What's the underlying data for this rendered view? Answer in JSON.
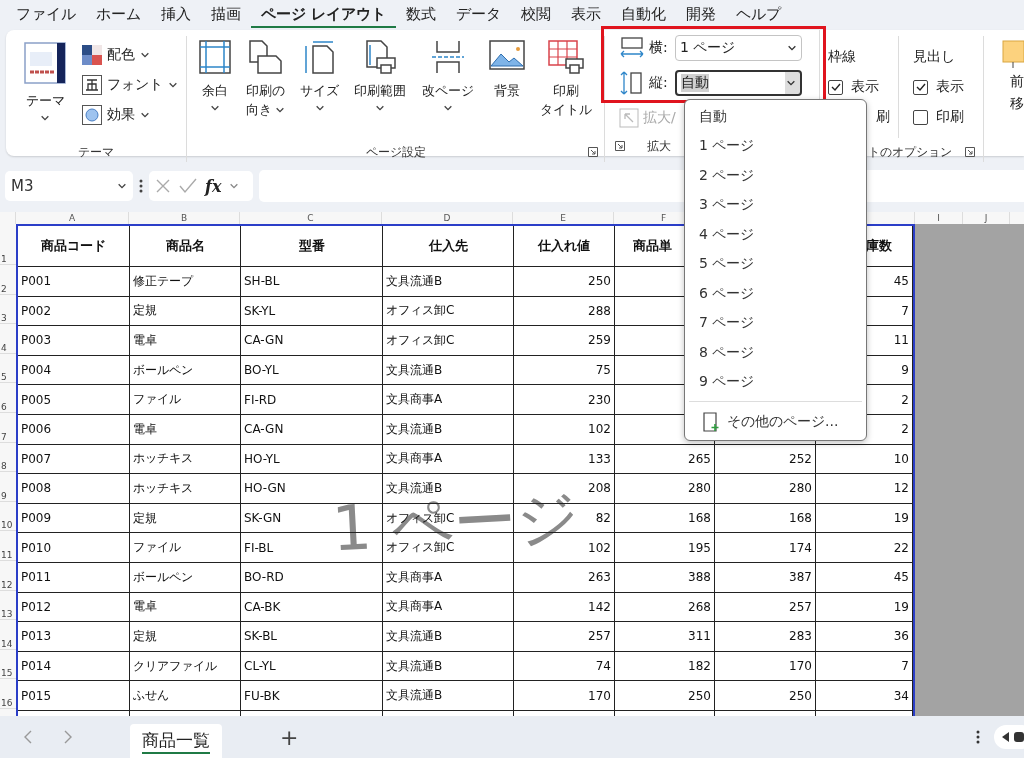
{
  "menu_tabs": [
    {
      "label": "ファイル",
      "selected": false
    },
    {
      "label": "ホーム",
      "selected": false
    },
    {
      "label": "挿入",
      "selected": false
    },
    {
      "label": "描画",
      "selected": false
    },
    {
      "label": "ページ レイアウト",
      "selected": true
    },
    {
      "label": "数式",
      "selected": false
    },
    {
      "label": "データ",
      "selected": false
    },
    {
      "label": "校閲",
      "selected": false
    },
    {
      "label": "表示",
      "selected": false
    },
    {
      "label": "自動化",
      "selected": false
    },
    {
      "label": "開発",
      "selected": false
    },
    {
      "label": "ヘルプ",
      "selected": false
    }
  ],
  "ribbon": {
    "theme_group": {
      "theme_button": "テーマ",
      "items": [
        {
          "label": "配色"
        },
        {
          "label": "フォント"
        },
        {
          "label": "効果"
        }
      ],
      "label": "テーマ"
    },
    "page_setup_group": {
      "buttons": [
        {
          "lines": [
            "余白"
          ],
          "dropdown": true
        },
        {
          "lines": [
            "印刷の",
            "向き"
          ],
          "dropdown": true
        },
        {
          "lines": [
            "サイズ"
          ],
          "dropdown": true
        },
        {
          "lines": [
            "印刷範囲"
          ],
          "dropdown": true
        },
        {
          "lines": [
            "改ページ"
          ],
          "dropdown": true
        },
        {
          "lines": [
            "背景"
          ],
          "dropdown": false
        },
        {
          "lines": [
            "印刷",
            "タイトル"
          ],
          "dropdown": false
        }
      ],
      "label": "ページ設定"
    },
    "scale_group": {
      "width": {
        "label": "横:",
        "value": "1 ページ",
        "open": false
      },
      "height": {
        "label": "縦:",
        "value": "自動",
        "open": true
      },
      "scale": {
        "label": "拡大/",
        "disabled": true
      },
      "label": "拡大"
    },
    "sheet_options_group": {
      "gridlines": {
        "title": "枠線",
        "view": {
          "label": "表示",
          "checked": true
        },
        "print_partial": "刷"
      },
      "headings": {
        "title": "見出し",
        "view": {
          "label": "表示",
          "checked": true
        },
        "print": {
          "label": "印刷",
          "checked": false
        }
      },
      "label": "トのオプション"
    },
    "arrange_group": {
      "lines": [
        "前",
        "移"
      ]
    }
  },
  "formula_bar": {
    "name_box": "M3",
    "fx": "fx"
  },
  "dropdown": {
    "items": [
      {
        "label": "自動",
        "selected": false
      },
      {
        "label": "1 ページ",
        "selected": false
      },
      {
        "label": "2 ページ",
        "selected": false
      },
      {
        "label": "3 ページ",
        "selected": false
      },
      {
        "label": "4 ページ",
        "selected": false
      },
      {
        "label": "5 ページ",
        "selected": false
      },
      {
        "label": "6 ページ",
        "selected": false
      },
      {
        "label": "7 ページ",
        "selected": false
      },
      {
        "label": "8 ページ",
        "selected": false
      },
      {
        "label": "9 ページ",
        "selected": false
      }
    ],
    "more": "その他のページ..."
  },
  "sheet": {
    "column_letters": [
      "A",
      "B",
      "C",
      "D",
      "E",
      "F",
      "I",
      "J"
    ],
    "row_numbers": [
      "1",
      "2",
      "3",
      "4",
      "5",
      "6",
      "7",
      "8",
      "9",
      "10",
      "11",
      "12",
      "13",
      "14",
      "15",
      "16"
    ],
    "header": [
      "商品コード",
      "商品名",
      "型番",
      "仕入先",
      "仕入れ値",
      "商品単",
      "庫数"
    ],
    "rows": [
      [
        "P001",
        "修正テープ",
        "SH-BL",
        "文具流通B",
        "250",
        null,
        null,
        "45"
      ],
      [
        "P002",
        "定規",
        "SK-YL",
        "オフィス卸C",
        "288",
        null,
        null,
        "7"
      ],
      [
        "P003",
        "電卓",
        "CA-GN",
        "オフィス卸C",
        "259",
        null,
        null,
        "11"
      ],
      [
        "P004",
        "ボールペン",
        "BO-YL",
        "文具流通B",
        "75",
        null,
        null,
        "9"
      ],
      [
        "P005",
        "ファイル",
        "FI-RD",
        "文具商事A",
        "230",
        null,
        null,
        "2"
      ],
      [
        "P006",
        "電卓",
        "CA-GN",
        "文具流通B",
        "102",
        null,
        null,
        "2"
      ],
      [
        "P007",
        "ホッチキス",
        "HO-YL",
        "文具商事A",
        "133",
        "265",
        "252",
        "10"
      ],
      [
        "P008",
        "ホッチキス",
        "HO-GN",
        "文具流通B",
        "208",
        "280",
        "280",
        "12"
      ],
      [
        "P009",
        "定規",
        "SK-GN",
        "オフィス卸C",
        "82",
        "168",
        "168",
        "19"
      ],
      [
        "P010",
        "ファイル",
        "FI-BL",
        "オフィス卸C",
        "102",
        "195",
        "174",
        "22"
      ],
      [
        "P011",
        "ボールペン",
        "BO-RD",
        "文具商事A",
        "263",
        "388",
        "387",
        "45"
      ],
      [
        "P012",
        "電卓",
        "CA-BK",
        "文具商事A",
        "142",
        "268",
        "257",
        "19"
      ],
      [
        "P013",
        "定規",
        "SK-BL",
        "文具流通B",
        "257",
        "311",
        "283",
        "36"
      ],
      [
        "P014",
        "クリアファイル",
        "CL-YL",
        "文具流通B",
        "74",
        "182",
        "170",
        "7"
      ],
      [
        "P015",
        "ふせん",
        "FU-BK",
        "文具流通B",
        "170",
        "250",
        "250",
        "34"
      ]
    ],
    "page_label": "1 ページ"
  },
  "sheet_tabs": {
    "tabs": [
      {
        "label": "商品一覧",
        "selected": true
      }
    ],
    "add": "+"
  }
}
